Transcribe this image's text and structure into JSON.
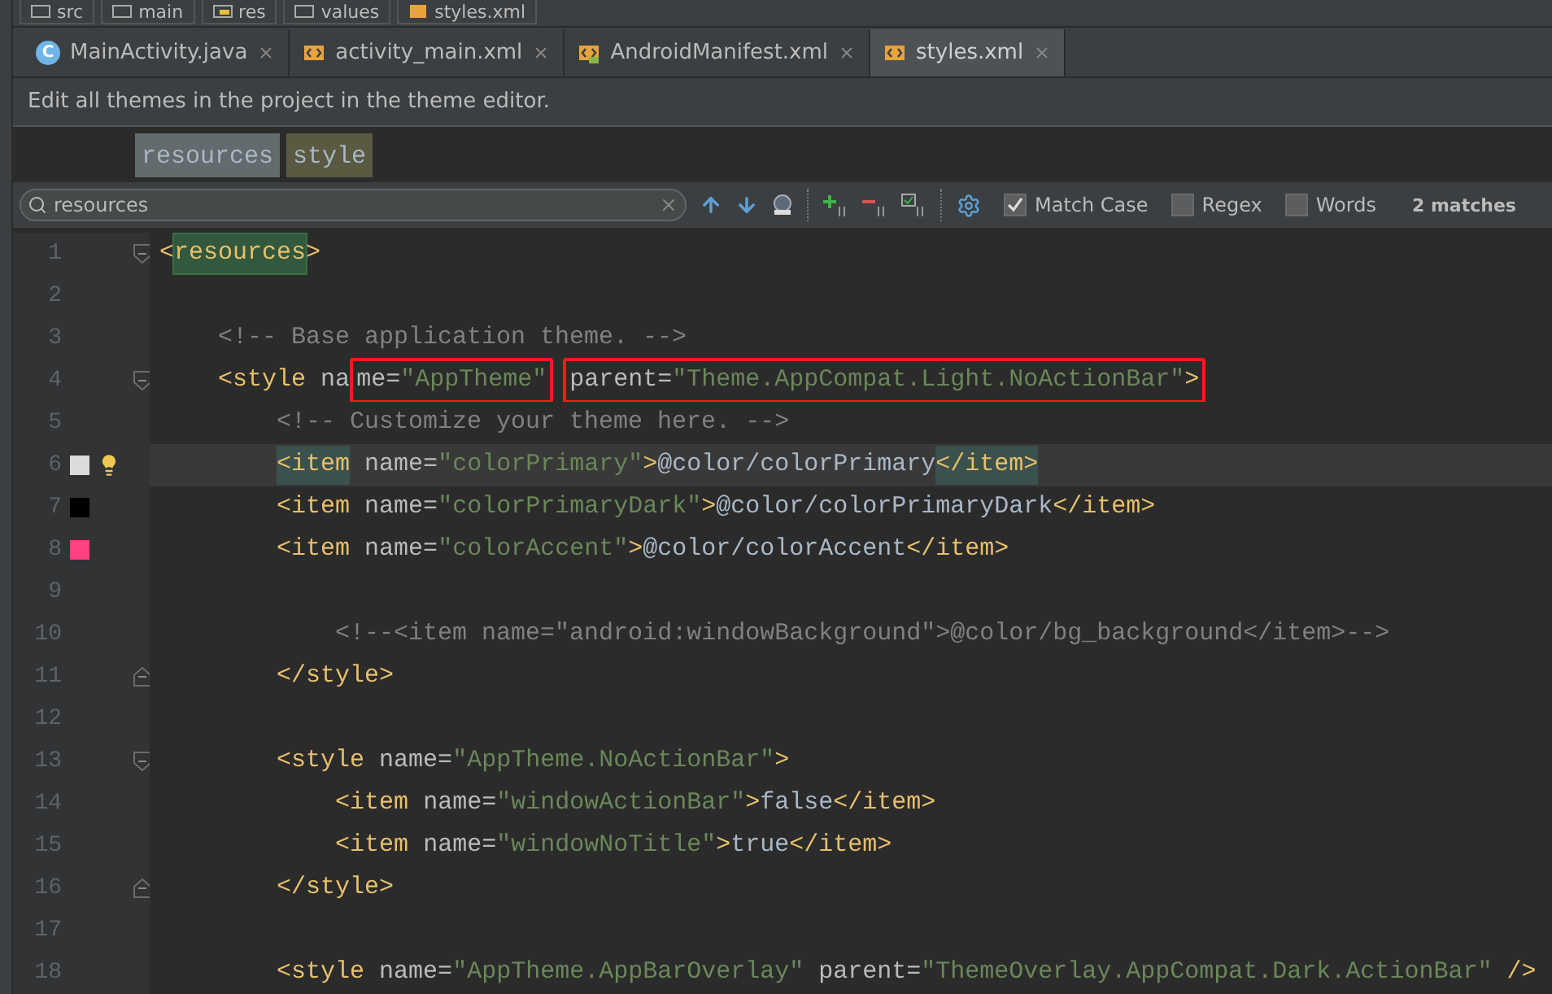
{
  "breadcrumbs": [
    {
      "label": "src",
      "kind": "folder"
    },
    {
      "label": "main",
      "kind": "folder"
    },
    {
      "label": "res",
      "kind": "res"
    },
    {
      "label": "values",
      "kind": "folder"
    },
    {
      "label": "styles.xml",
      "kind": "xml"
    }
  ],
  "tabs": [
    {
      "label": "MainActivity.java",
      "kind": "java",
      "icon_letter": "C",
      "selected": false
    },
    {
      "label": "activity_main.xml",
      "kind": "xml",
      "selected": false
    },
    {
      "label": "AndroidManifest.xml",
      "kind": "manifest",
      "selected": false
    },
    {
      "label": "styles.xml",
      "kind": "xml",
      "selected": true
    }
  ],
  "banner": "Edit all themes in the project in the theme editor.",
  "tag_path": [
    {
      "label": "resources",
      "selected": true
    },
    {
      "label": "style",
      "selected": false
    }
  ],
  "search": {
    "value": "resources",
    "match_case": {
      "label": "Match Case",
      "checked": true
    },
    "regex": {
      "label": "Regex",
      "checked": false
    },
    "words": {
      "label": "Words",
      "checked": false
    },
    "result": "2 matches"
  },
  "lines": [
    {
      "number": "1",
      "current": false,
      "fold_start": true,
      "tokens": [
        {
          "kind": "tag",
          "text": "<"
        },
        {
          "kind": "tag",
          "text": "resources",
          "search_match": true
        },
        {
          "kind": "tag",
          "text": ">"
        }
      ]
    },
    {
      "number": "2",
      "current": false
    },
    {
      "number": "3",
      "current": false,
      "tokens": [
        {
          "kind": "comment",
          "text": "    <!-- Base application theme. -->"
        }
      ]
    },
    {
      "number": "4",
      "current": false,
      "fold_start": true,
      "tokens": [
        {
          "kind": "tag",
          "text": "    <style"
        },
        {
          "kind": "attr",
          "text": " na"
        },
        {
          "kind": "annotation",
          "tokens": [
            {
              "kind": "attr",
              "text": "me="
            },
            {
              "kind": "value",
              "text": "\"AppTheme\""
            }
          ]
        },
        {
          "kind": "annotation",
          "tokens": [
            {
              "kind": "attr",
              "text": "parent="
            },
            {
              "kind": "value",
              "text": "\"Theme.AppCompat.Light.NoActionBar\""
            },
            {
              "kind": "tag",
              "text": ">"
            }
          ]
        }
      ]
    },
    {
      "number": "5",
      "current": false,
      "tokens": [
        {
          "kind": "comment",
          "text": "        <!-- Customize your theme here. -->"
        }
      ]
    },
    {
      "number": "6",
      "current": true,
      "color": "#dcdcdc",
      "bulb": true,
      "tokens": [
        {
          "kind": "tag",
          "text": "        <item",
          "brace_match": true
        },
        {
          "kind": "attr",
          "text": " name="
        },
        {
          "kind": "value",
          "text": "\"colorPrimary\""
        },
        {
          "kind": "tag",
          "text": ">"
        },
        {
          "kind": "text",
          "text": "@color/colorPrimary"
        },
        {
          "kind": "tag",
          "text": "</item>",
          "brace_match": true
        }
      ]
    },
    {
      "number": "7",
      "current": false,
      "color": "#000000",
      "tokens": [
        {
          "kind": "tag",
          "text": "        <item"
        },
        {
          "kind": "attr",
          "text": " name="
        },
        {
          "kind": "value",
          "text": "\"colorPrimaryDark\""
        },
        {
          "kind": "tag",
          "text": ">"
        },
        {
          "kind": "text",
          "text": "@color/colorPrimaryDark"
        },
        {
          "kind": "tag",
          "text": "</item>"
        }
      ]
    },
    {
      "number": "8",
      "current": false,
      "color": "#ff4081",
      "tokens": [
        {
          "kind": "tag",
          "text": "        <item"
        },
        {
          "kind": "attr",
          "text": " name="
        },
        {
          "kind": "value",
          "text": "\"colorAccent\""
        },
        {
          "kind": "tag",
          "text": ">"
        },
        {
          "kind": "text",
          "text": "@color/colorAccent"
        },
        {
          "kind": "tag",
          "text": "</item>"
        }
      ]
    },
    {
      "number": "9",
      "current": false
    },
    {
      "number": "10",
      "current": false,
      "tokens": [
        {
          "kind": "comment",
          "text": "            <!--<item name=\"android:windowBackground\">@color/bg_background</item>-->"
        }
      ]
    },
    {
      "number": "11",
      "current": false,
      "fold_end": true,
      "tokens": [
        {
          "kind": "tag",
          "text": "        </style>"
        }
      ]
    },
    {
      "number": "12",
      "current": false
    },
    {
      "number": "13",
      "current": false,
      "fold_start": true,
      "tokens": [
        {
          "kind": "tag",
          "text": "        <style"
        },
        {
          "kind": "attr",
          "text": " name="
        },
        {
          "kind": "value",
          "text": "\"AppTheme.NoActionBar\""
        },
        {
          "kind": "tag",
          "text": ">"
        }
      ]
    },
    {
      "number": "14",
      "current": false,
      "tokens": [
        {
          "kind": "tag",
          "text": "            <item"
        },
        {
          "kind": "attr",
          "text": " name="
        },
        {
          "kind": "value",
          "text": "\"windowActionBar\""
        },
        {
          "kind": "tag",
          "text": ">"
        },
        {
          "kind": "text",
          "text": "false"
        },
        {
          "kind": "tag",
          "text": "</item>"
        }
      ]
    },
    {
      "number": "15",
      "current": false,
      "tokens": [
        {
          "kind": "tag",
          "text": "            <item"
        },
        {
          "kind": "attr",
          "text": " name="
        },
        {
          "kind": "value",
          "text": "\"windowNoTitle\""
        },
        {
          "kind": "tag",
          "text": ">"
        },
        {
          "kind": "text",
          "text": "true"
        },
        {
          "kind": "tag",
          "text": "</item>"
        }
      ]
    },
    {
      "number": "16",
      "current": false,
      "fold_end": true,
      "tokens": [
        {
          "kind": "tag",
          "text": "        </style>"
        }
      ]
    },
    {
      "number": "17",
      "current": false
    },
    {
      "number": "18",
      "current": false,
      "tokens": [
        {
          "kind": "tag",
          "text": "        <style"
        },
        {
          "kind": "attr",
          "text": " name="
        },
        {
          "kind": "value",
          "text": "\"AppTheme.AppBarOverlay\""
        },
        {
          "kind": "attr",
          "text": " parent="
        },
        {
          "kind": "value",
          "text": "\"ThemeOverlay.AppCompat.Dark.ActionBar\""
        },
        {
          "kind": "tag",
          "text": " />"
        }
      ]
    }
  ]
}
